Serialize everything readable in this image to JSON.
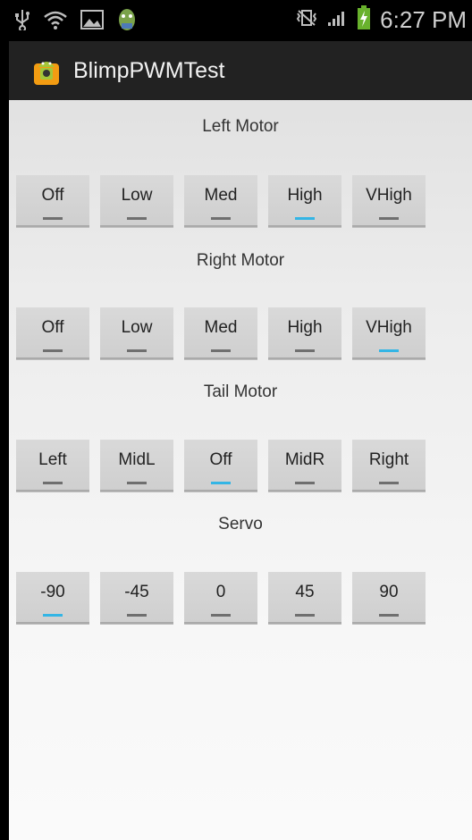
{
  "status_bar": {
    "time": "6:27 PM"
  },
  "action_bar": {
    "title": "BlimpPWMTest"
  },
  "colors": {
    "indicator_on": "#33b5e5",
    "indicator_off": "#6f6f6f"
  },
  "sections": [
    {
      "label": "Left Motor",
      "buttons": [
        {
          "label": "Off",
          "on": false
        },
        {
          "label": "Low",
          "on": false
        },
        {
          "label": "Med",
          "on": false
        },
        {
          "label": "High",
          "on": true
        },
        {
          "label": "VHigh",
          "on": false
        }
      ]
    },
    {
      "label": "Right Motor",
      "buttons": [
        {
          "label": "Off",
          "on": false
        },
        {
          "label": "Low",
          "on": false
        },
        {
          "label": "Med",
          "on": false
        },
        {
          "label": "High",
          "on": false
        },
        {
          "label": "VHigh",
          "on": true
        }
      ]
    },
    {
      "label": "Tail Motor",
      "buttons": [
        {
          "label": "Left",
          "on": false
        },
        {
          "label": "MidL",
          "on": false
        },
        {
          "label": "Off",
          "on": true
        },
        {
          "label": "MidR",
          "on": false
        },
        {
          "label": "Right",
          "on": false
        }
      ]
    },
    {
      "label": "Servo",
      "buttons": [
        {
          "label": "-90",
          "on": true
        },
        {
          "label": "-45",
          "on": false
        },
        {
          "label": "0",
          "on": false
        },
        {
          "label": "45",
          "on": false
        },
        {
          "label": "90",
          "on": false
        }
      ]
    }
  ]
}
